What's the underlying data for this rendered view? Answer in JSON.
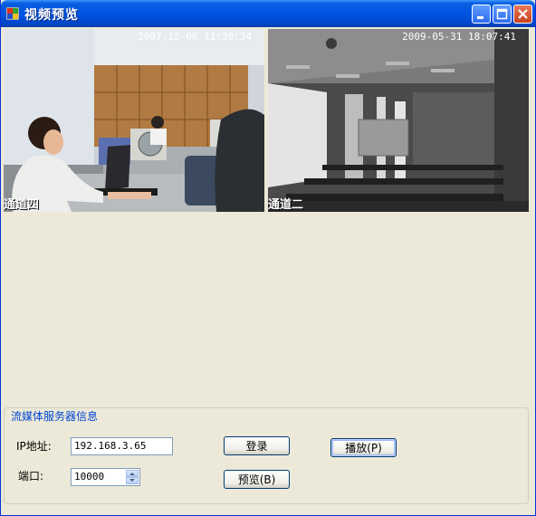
{
  "window": {
    "title": "视频预览",
    "buttons": {
      "minimize": "minimize-icon",
      "maximize": "maximize-icon",
      "close": "close-icon"
    }
  },
  "videos": [
    {
      "timestamp": "2007-12-06 11:30:34",
      "channel": "通道四"
    },
    {
      "timestamp": "2009-05-31 18:07:41",
      "channel": "通道二"
    }
  ],
  "server_group": {
    "legend": "流媒体服务器信息",
    "ip_label": "IP地址:",
    "ip_value": "192.168.3.65",
    "port_label": "端口:",
    "port_value": "10000",
    "login_button": "登录",
    "play_button": "播放(P)",
    "preview_button": "预览(B)"
  },
  "colors": {
    "title_bar": "#0054e3",
    "group_legend": "#0046d5",
    "window_bg": "#ece9d8"
  }
}
